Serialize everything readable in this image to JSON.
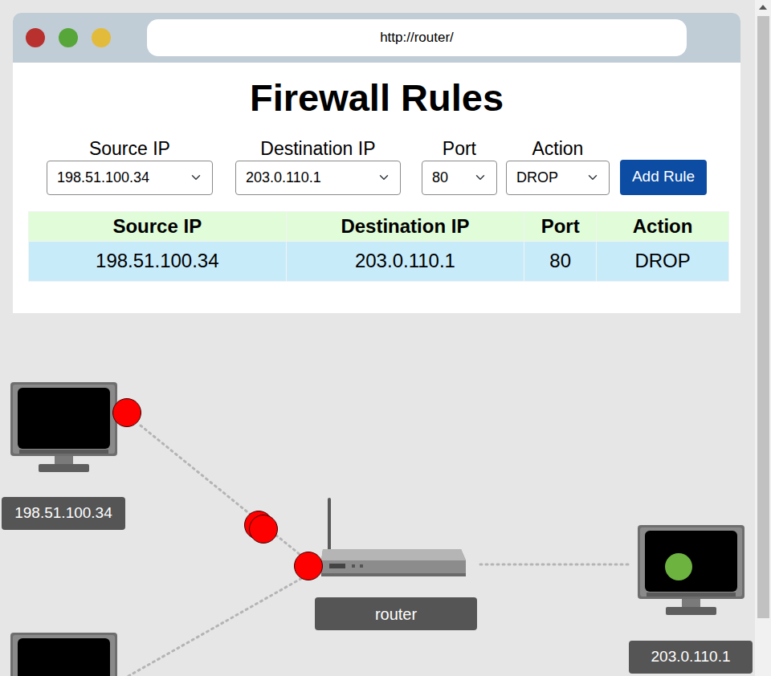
{
  "browser": {
    "url": "http://router/"
  },
  "title": "Firewall Rules",
  "form": {
    "fields": [
      {
        "label": "Source IP",
        "value": "198.51.100.34"
      },
      {
        "label": "Destination IP",
        "value": "203.0.110.1"
      },
      {
        "label": "Port",
        "value": "80"
      },
      {
        "label": "Action",
        "value": "DROP"
      }
    ],
    "button": "Add Rule"
  },
  "table": {
    "columns": [
      "Source IP",
      "Destination IP",
      "Port",
      "Action"
    ],
    "rows": [
      [
        "198.51.100.34",
        "203.0.110.1",
        "80",
        "DROP"
      ]
    ]
  },
  "diagram": {
    "nodes": [
      {
        "label": "198.51.100.34",
        "kind": "computer"
      },
      {
        "label": "router",
        "kind": "router"
      },
      {
        "label": "203.0.110.1",
        "kind": "computer"
      }
    ],
    "packets": [
      {
        "color": "#ff0000"
      },
      {
        "color": "#ff0000"
      },
      {
        "color": "#ff0000"
      },
      {
        "color": "#ff0000"
      },
      {
        "color": "#6db33f"
      }
    ]
  }
}
